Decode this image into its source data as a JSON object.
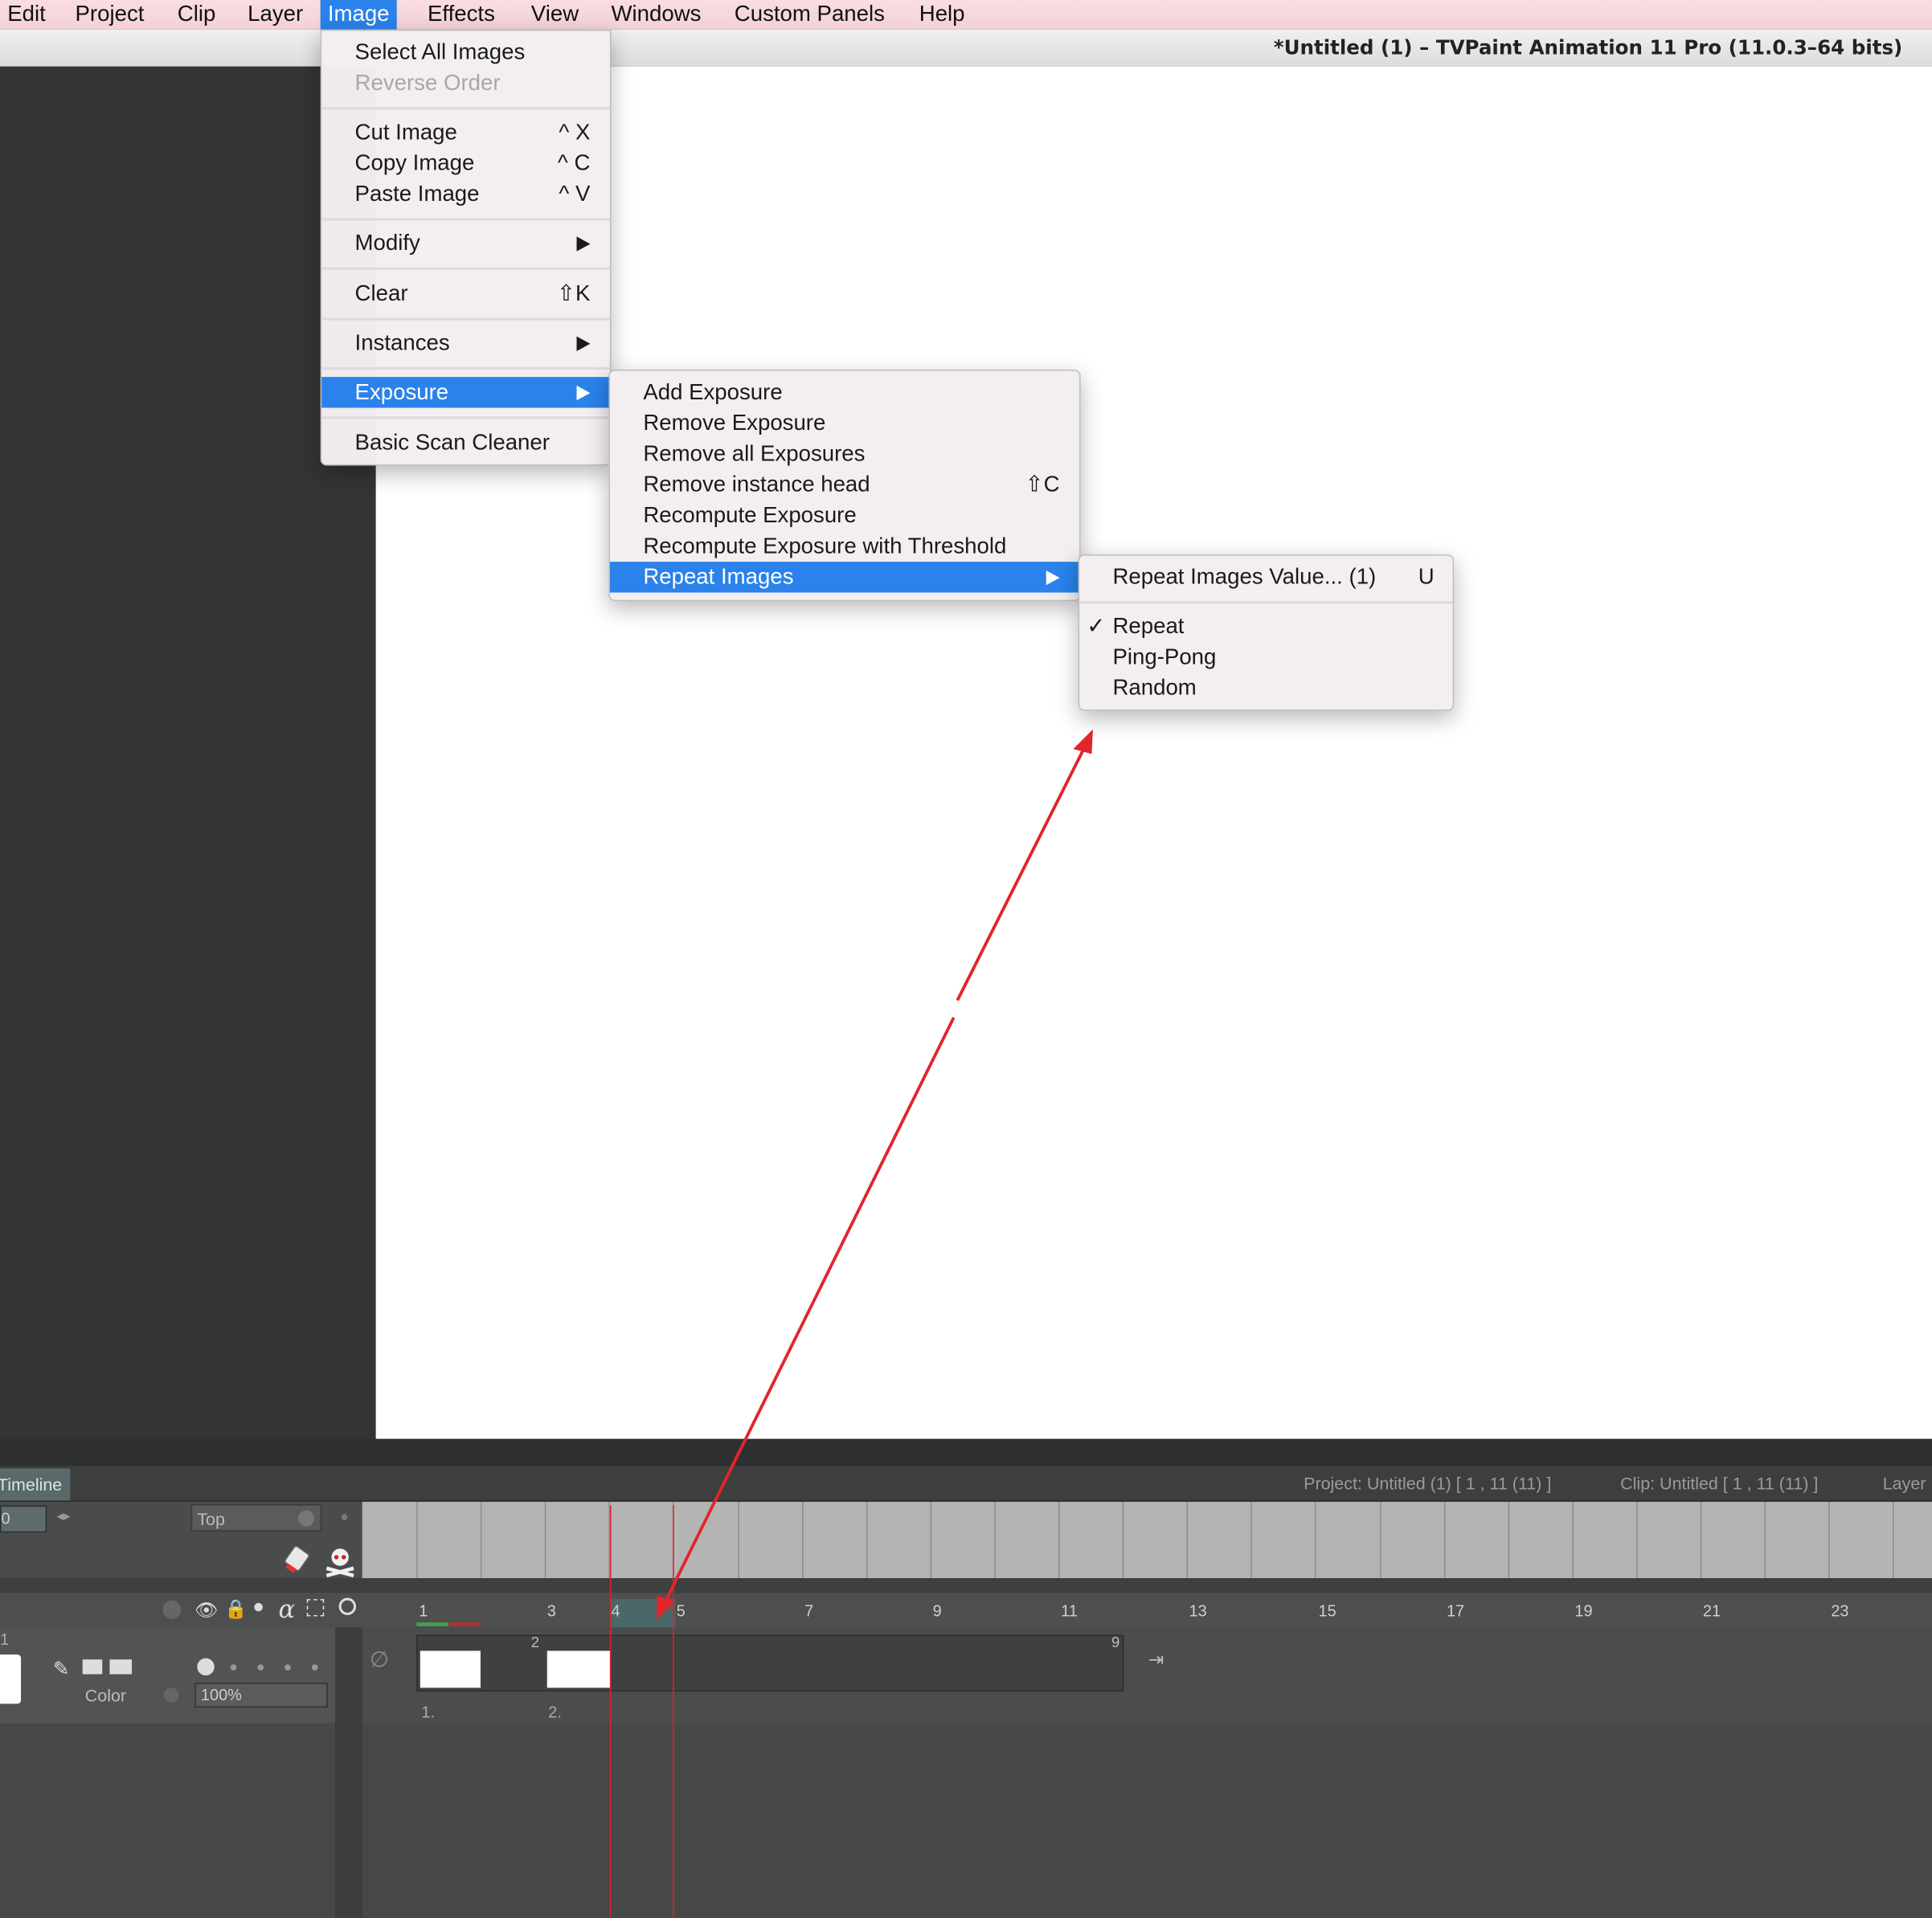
{
  "window": {
    "title": "*Untitled (1) – TVPaint Animation 11 Pro (11.0.3–64 bits)"
  },
  "menubar": {
    "items": [
      "Edit",
      "Project",
      "Clip",
      "Layer",
      "Image",
      "Effects",
      "View",
      "Windows",
      "Custom Panels",
      "Help"
    ],
    "active": "Image"
  },
  "image_menu": {
    "select_all": "Select All Images",
    "reverse_order": "Reverse Order",
    "cut": {
      "label": "Cut Image",
      "shortcut": "^ X"
    },
    "copy": {
      "label": "Copy Image",
      "shortcut": "^ C"
    },
    "paste": {
      "label": "Paste Image",
      "shortcut": "^ V"
    },
    "modify": "Modify",
    "clear": {
      "label": "Clear",
      "shortcut": "⇧K"
    },
    "instances": "Instances",
    "exposure": "Exposure",
    "basic_scan_cleaner": "Basic Scan Cleaner"
  },
  "exposure_menu": {
    "add": "Add Exposure",
    "remove": "Remove Exposure",
    "remove_all": "Remove all Exposures",
    "remove_instance_head": {
      "label": "Remove instance head",
      "shortcut": "⇧C"
    },
    "recompute": "Recompute Exposure",
    "recompute_threshold": "Recompute Exposure with Threshold",
    "repeat_images": "Repeat Images"
  },
  "repeat_menu": {
    "value": {
      "label": "Repeat Images Value... (1)",
      "shortcut": "U"
    },
    "check": "✓",
    "repeat": "Repeat",
    "ping_pong": "Ping-Pong",
    "random": "Random"
  },
  "timeline": {
    "tab": "Timeline",
    "frame_field": "0",
    "top_select": "Top",
    "project_info": "Project: Untitled (1) [ 1 , 11  (11) ]",
    "clip_info": "Clip: Untitled [ 1 , 11  (11) ]",
    "layer_info": "Layer",
    "layer_index": "1",
    "ruler": [
      "1",
      "3",
      "4",
      "5",
      "7",
      "9",
      "11",
      "13",
      "15",
      "17",
      "19",
      "21",
      "23"
    ],
    "instance_labels": [
      "1.",
      "2."
    ],
    "instance_counts": [
      "2",
      "9"
    ],
    "color_label": "Color",
    "opacity": "100%"
  },
  "colors": {
    "accent": "#2a82ea",
    "annotation": "#e0262b",
    "canvas": "#ffffff",
    "menubar": "#f6d8dc"
  }
}
